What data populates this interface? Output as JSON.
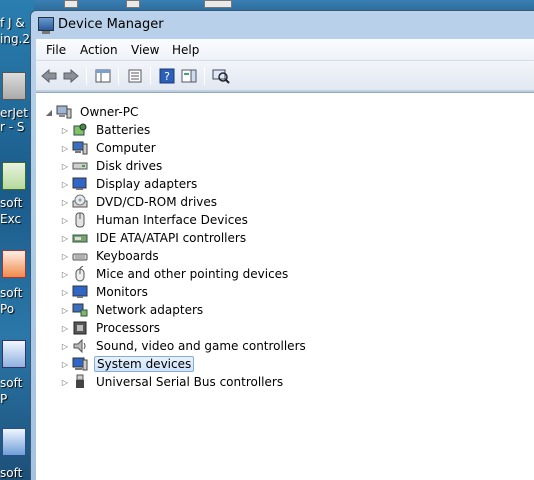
{
  "window": {
    "title": "Device Manager"
  },
  "desktop": {
    "icons": [
      {
        "label_line1": "f J &",
        "label_line2": "ing.2"
      },
      {
        "label_line1": "erJet",
        "label_line2": "r - S"
      },
      {
        "label_line1": "soft",
        "label_line2": "Exc"
      },
      {
        "label_line1": "soft",
        "label_line2": "Po"
      },
      {
        "label_line1": "soft",
        "label_line2": "P"
      },
      {
        "label_line1": "soft",
        "label_line2": ""
      }
    ]
  },
  "menubar": {
    "items": [
      "File",
      "Action",
      "View",
      "Help"
    ]
  },
  "toolbar": {
    "buttons": [
      "back-icon",
      "forward-icon",
      "show-hide-console-tree-icon",
      "properties-icon",
      "help-icon",
      "action-pane-icon",
      "scan-hardware-icon"
    ]
  },
  "tree": {
    "root": "Owner-PC",
    "items": [
      {
        "label": "Batteries",
        "icon": "battery-icon"
      },
      {
        "label": "Computer",
        "icon": "computer-icon"
      },
      {
        "label": "Disk drives",
        "icon": "disk-drive-icon"
      },
      {
        "label": "Display adapters",
        "icon": "display-adapter-icon"
      },
      {
        "label": "DVD/CD-ROM drives",
        "icon": "dvd-drive-icon"
      },
      {
        "label": "Human Interface Devices",
        "icon": "hid-icon"
      },
      {
        "label": "IDE ATA/ATAPI controllers",
        "icon": "ide-controller-icon"
      },
      {
        "label": "Keyboards",
        "icon": "keyboard-icon"
      },
      {
        "label": "Mice and other pointing devices",
        "icon": "mouse-icon"
      },
      {
        "label": "Monitors",
        "icon": "monitor-icon"
      },
      {
        "label": "Network adapters",
        "icon": "network-adapter-icon"
      },
      {
        "label": "Processors",
        "icon": "processor-icon"
      },
      {
        "label": "Sound, video and game controllers",
        "icon": "speaker-icon"
      },
      {
        "label": "System devices",
        "icon": "system-device-icon",
        "selected": true
      },
      {
        "label": "Universal Serial Bus controllers",
        "icon": "usb-icon"
      }
    ]
  }
}
